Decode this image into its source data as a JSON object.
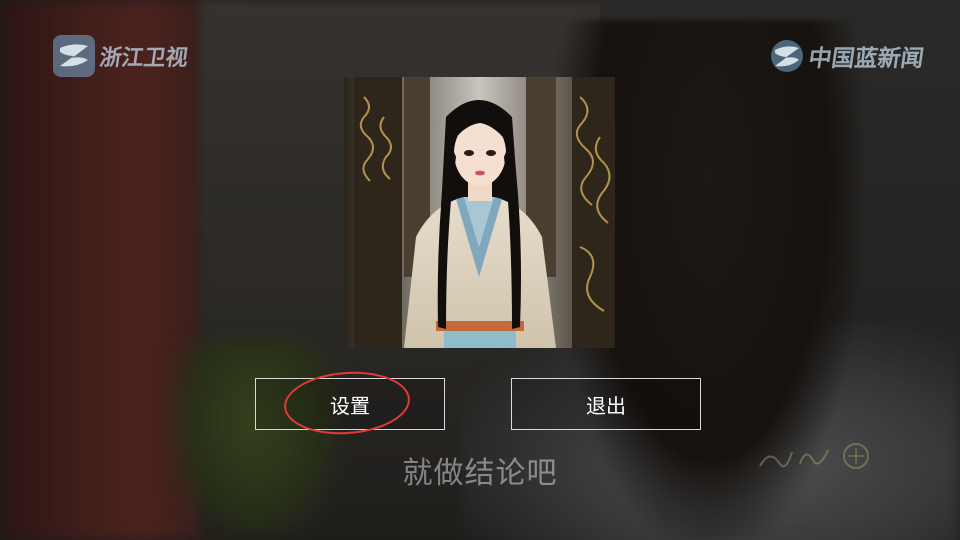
{
  "broadcast": {
    "channel_logo_text": "浙江卫视",
    "news_logo_text": "中国蓝新闻",
    "subtitle": "就做结论吧"
  },
  "dialog": {
    "image_icon": "portrait-image",
    "settings_label": "设置",
    "exit_label": "退出",
    "highlighted": "settings"
  },
  "colors": {
    "button_border": "#d8d8d8",
    "button_text": "#ffffff",
    "highlight_ring": "#e23a3a",
    "logo_text": "#c8dceb"
  }
}
